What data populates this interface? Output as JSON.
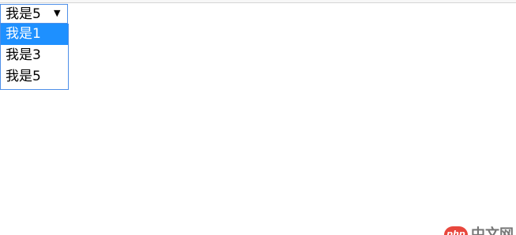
{
  "select": {
    "selected_value": "我是5",
    "arrow_icon": "triangle-down-icon",
    "options": [
      {
        "label": "我是1",
        "highlighted": true
      },
      {
        "label": "我是3",
        "highlighted": false
      },
      {
        "label": "我是5",
        "highlighted": false
      }
    ]
  },
  "watermark": {
    "logo_text": "php",
    "site_text": "中文网"
  },
  "colors": {
    "focus_border": "#4d8fe8",
    "highlight_bg": "#1e90ff",
    "watermark_red": "#e8473d"
  }
}
